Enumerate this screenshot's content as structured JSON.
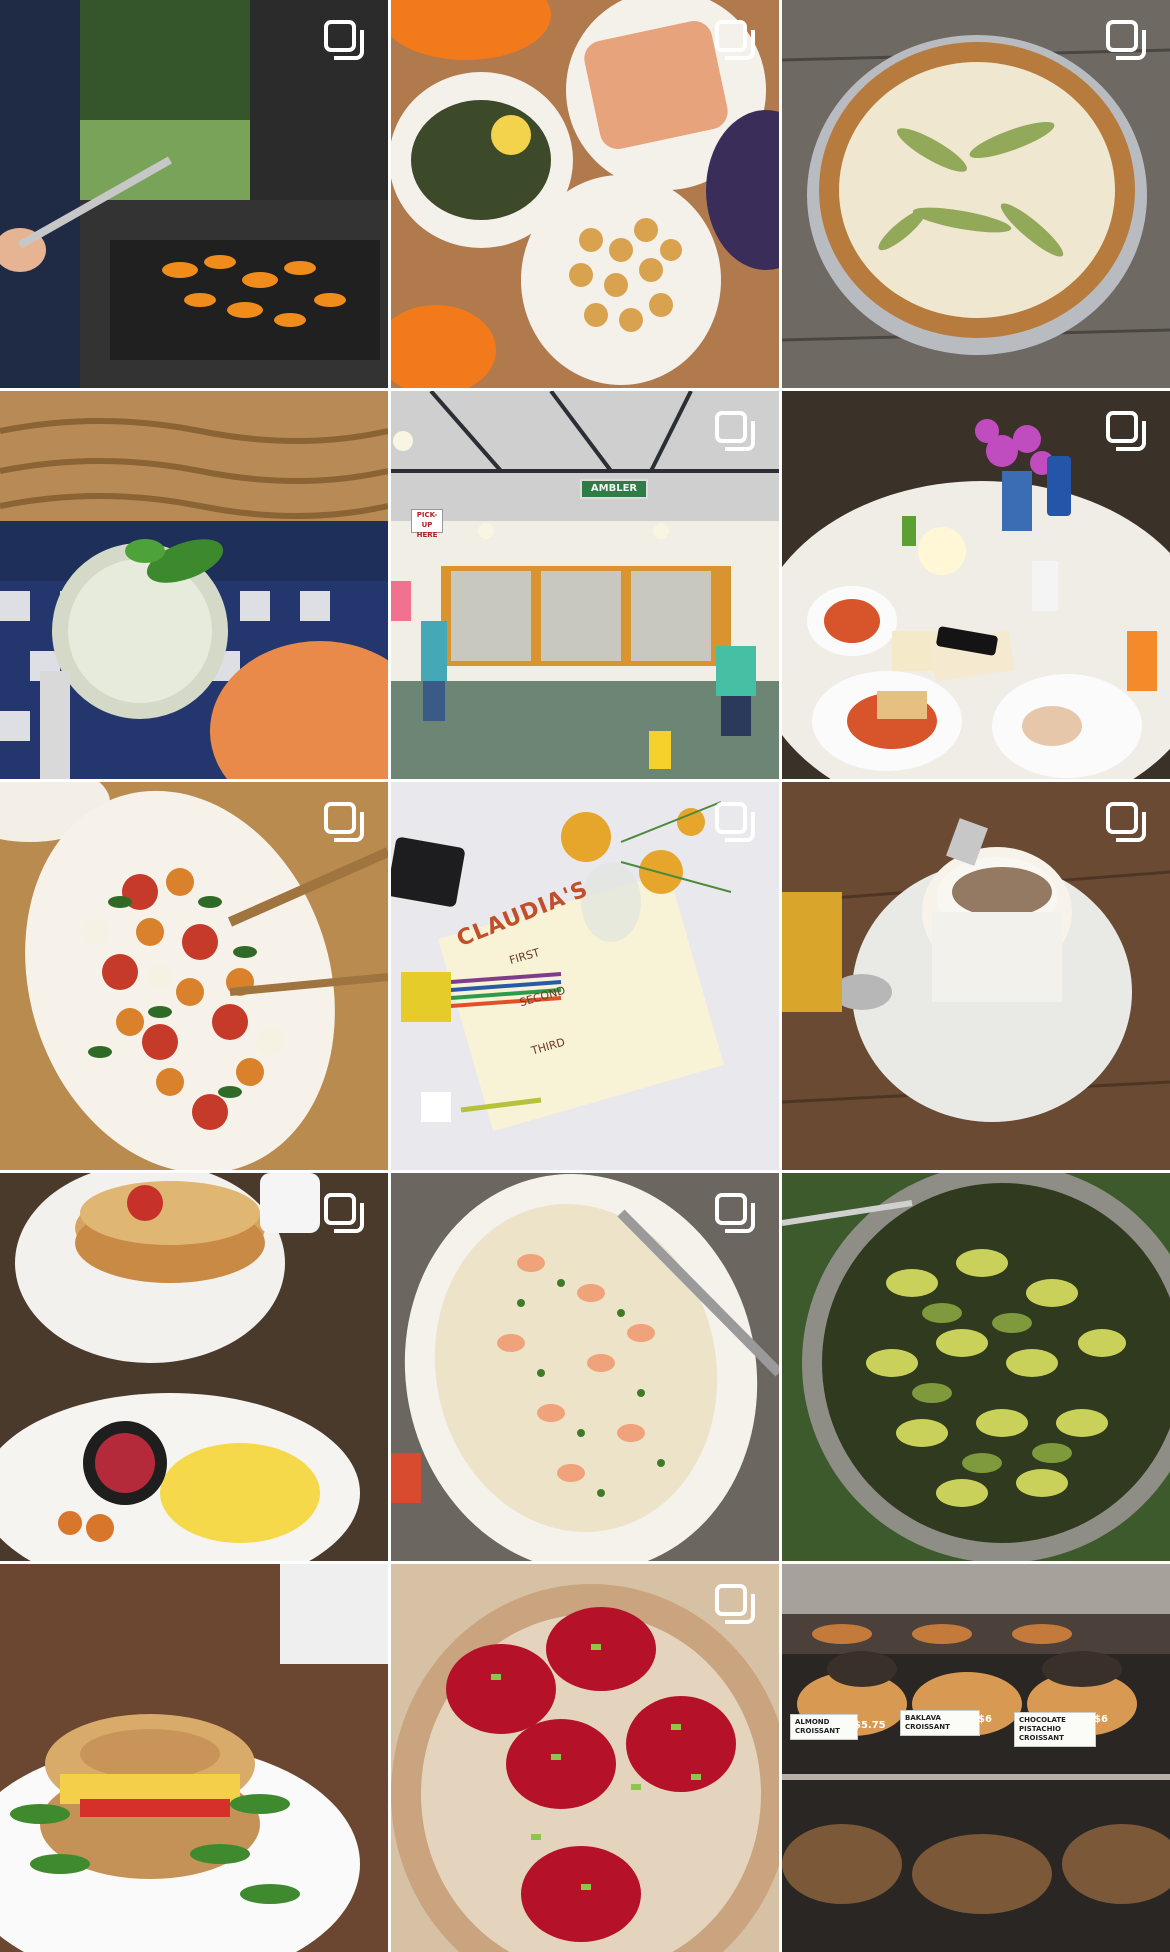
{
  "grid": {
    "tiles": [
      {
        "id": "grill",
        "multi": true
      },
      {
        "id": "salmon-asparagus-potatoes",
        "multi": true
      },
      {
        "id": "pesto-pizza",
        "multi": true
      },
      {
        "id": "lemonade-basil",
        "multi": false
      },
      {
        "id": "ambler-cafe",
        "multi": true
      },
      {
        "id": "dinner-table",
        "multi": true
      },
      {
        "id": "caprese-peach-salad",
        "multi": true
      },
      {
        "id": "claudias-menu",
        "multi": true
      },
      {
        "id": "cappuccino",
        "multi": true
      },
      {
        "id": "pancakes-eggs",
        "multi": true
      },
      {
        "id": "shrimp-pasta",
        "multi": true
      },
      {
        "id": "pesto-farfalle",
        "multi": false
      },
      {
        "id": "bagel-sandwich",
        "multi": false
      },
      {
        "id": "beet-ravioli",
        "multi": true
      },
      {
        "id": "bakery-case",
        "multi": false
      }
    ]
  },
  "signs": {
    "ambler": "AMBLER",
    "pickup": "PICK-UP HERE"
  },
  "menu": {
    "title": "CLAUDIA'S",
    "first": "FIRST",
    "second": "SECOND",
    "third": "THIRD"
  },
  "bakery": {
    "almond_label": "ALMOND CROISSANT",
    "almond_price": "$5.75",
    "baklava_label": "BAKLAVA CROISSANT",
    "baklava_price": "$6",
    "choc_label": "CHOCOLATE PISTACHIO CROISSANT",
    "choc_price": "$6"
  },
  "icons": {
    "multi_post": "multiple-photos-icon"
  },
  "colors": {
    "icon_white": "#ffffff",
    "background": "#ffffff"
  }
}
